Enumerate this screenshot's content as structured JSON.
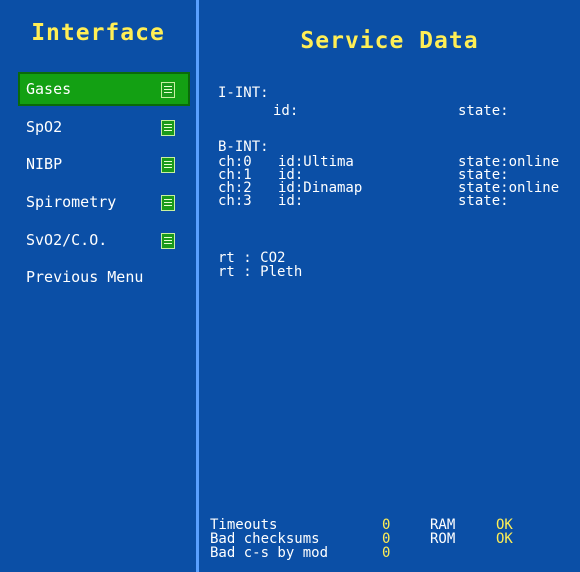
{
  "left_panel": {
    "title": "Interface",
    "items": [
      {
        "label": "Gases",
        "has_icon": true,
        "selected": true
      },
      {
        "label": "SpO2",
        "has_icon": true,
        "selected": false
      },
      {
        "label": "NIBP",
        "has_icon": true,
        "selected": false
      },
      {
        "label": "Spirometry",
        "has_icon": true,
        "selected": false
      },
      {
        "label": "SvO2/C.O.",
        "has_icon": true,
        "selected": false
      },
      {
        "label": "Previous Menu",
        "has_icon": false,
        "selected": false
      }
    ]
  },
  "service": {
    "title": "Service Data",
    "i_int": {
      "header": "I-INT:",
      "id_label": "id:",
      "state_label": "state:"
    },
    "b_int": {
      "header": "B-INT:",
      "channels": [
        {
          "ch": "ch:0",
          "id": "id:Ultima",
          "state": "state:online"
        },
        {
          "ch": "ch:1",
          "id": "id:",
          "state": "state:"
        },
        {
          "ch": "ch:2",
          "id": "id:Dinamap",
          "state": "state:online"
        },
        {
          "ch": "ch:3",
          "id": "id:",
          "state": "state:"
        }
      ]
    },
    "rt": [
      "rt : CO2",
      "rt : Pleth"
    ],
    "stats": [
      {
        "label": "Timeouts",
        "value": "0"
      },
      {
        "label": "Bad checksums",
        "value": "0"
      },
      {
        "label": "Bad c-s by mod",
        "value": "0"
      }
    ],
    "memory": [
      {
        "label": "RAM",
        "status": "OK"
      },
      {
        "label": "ROM",
        "status": "OK"
      }
    ]
  },
  "colors": {
    "background": "#0b4fa6",
    "divider": "#5aa0ff",
    "title": "#ffee55",
    "selected": "#13a013",
    "text": "#ffffff"
  }
}
